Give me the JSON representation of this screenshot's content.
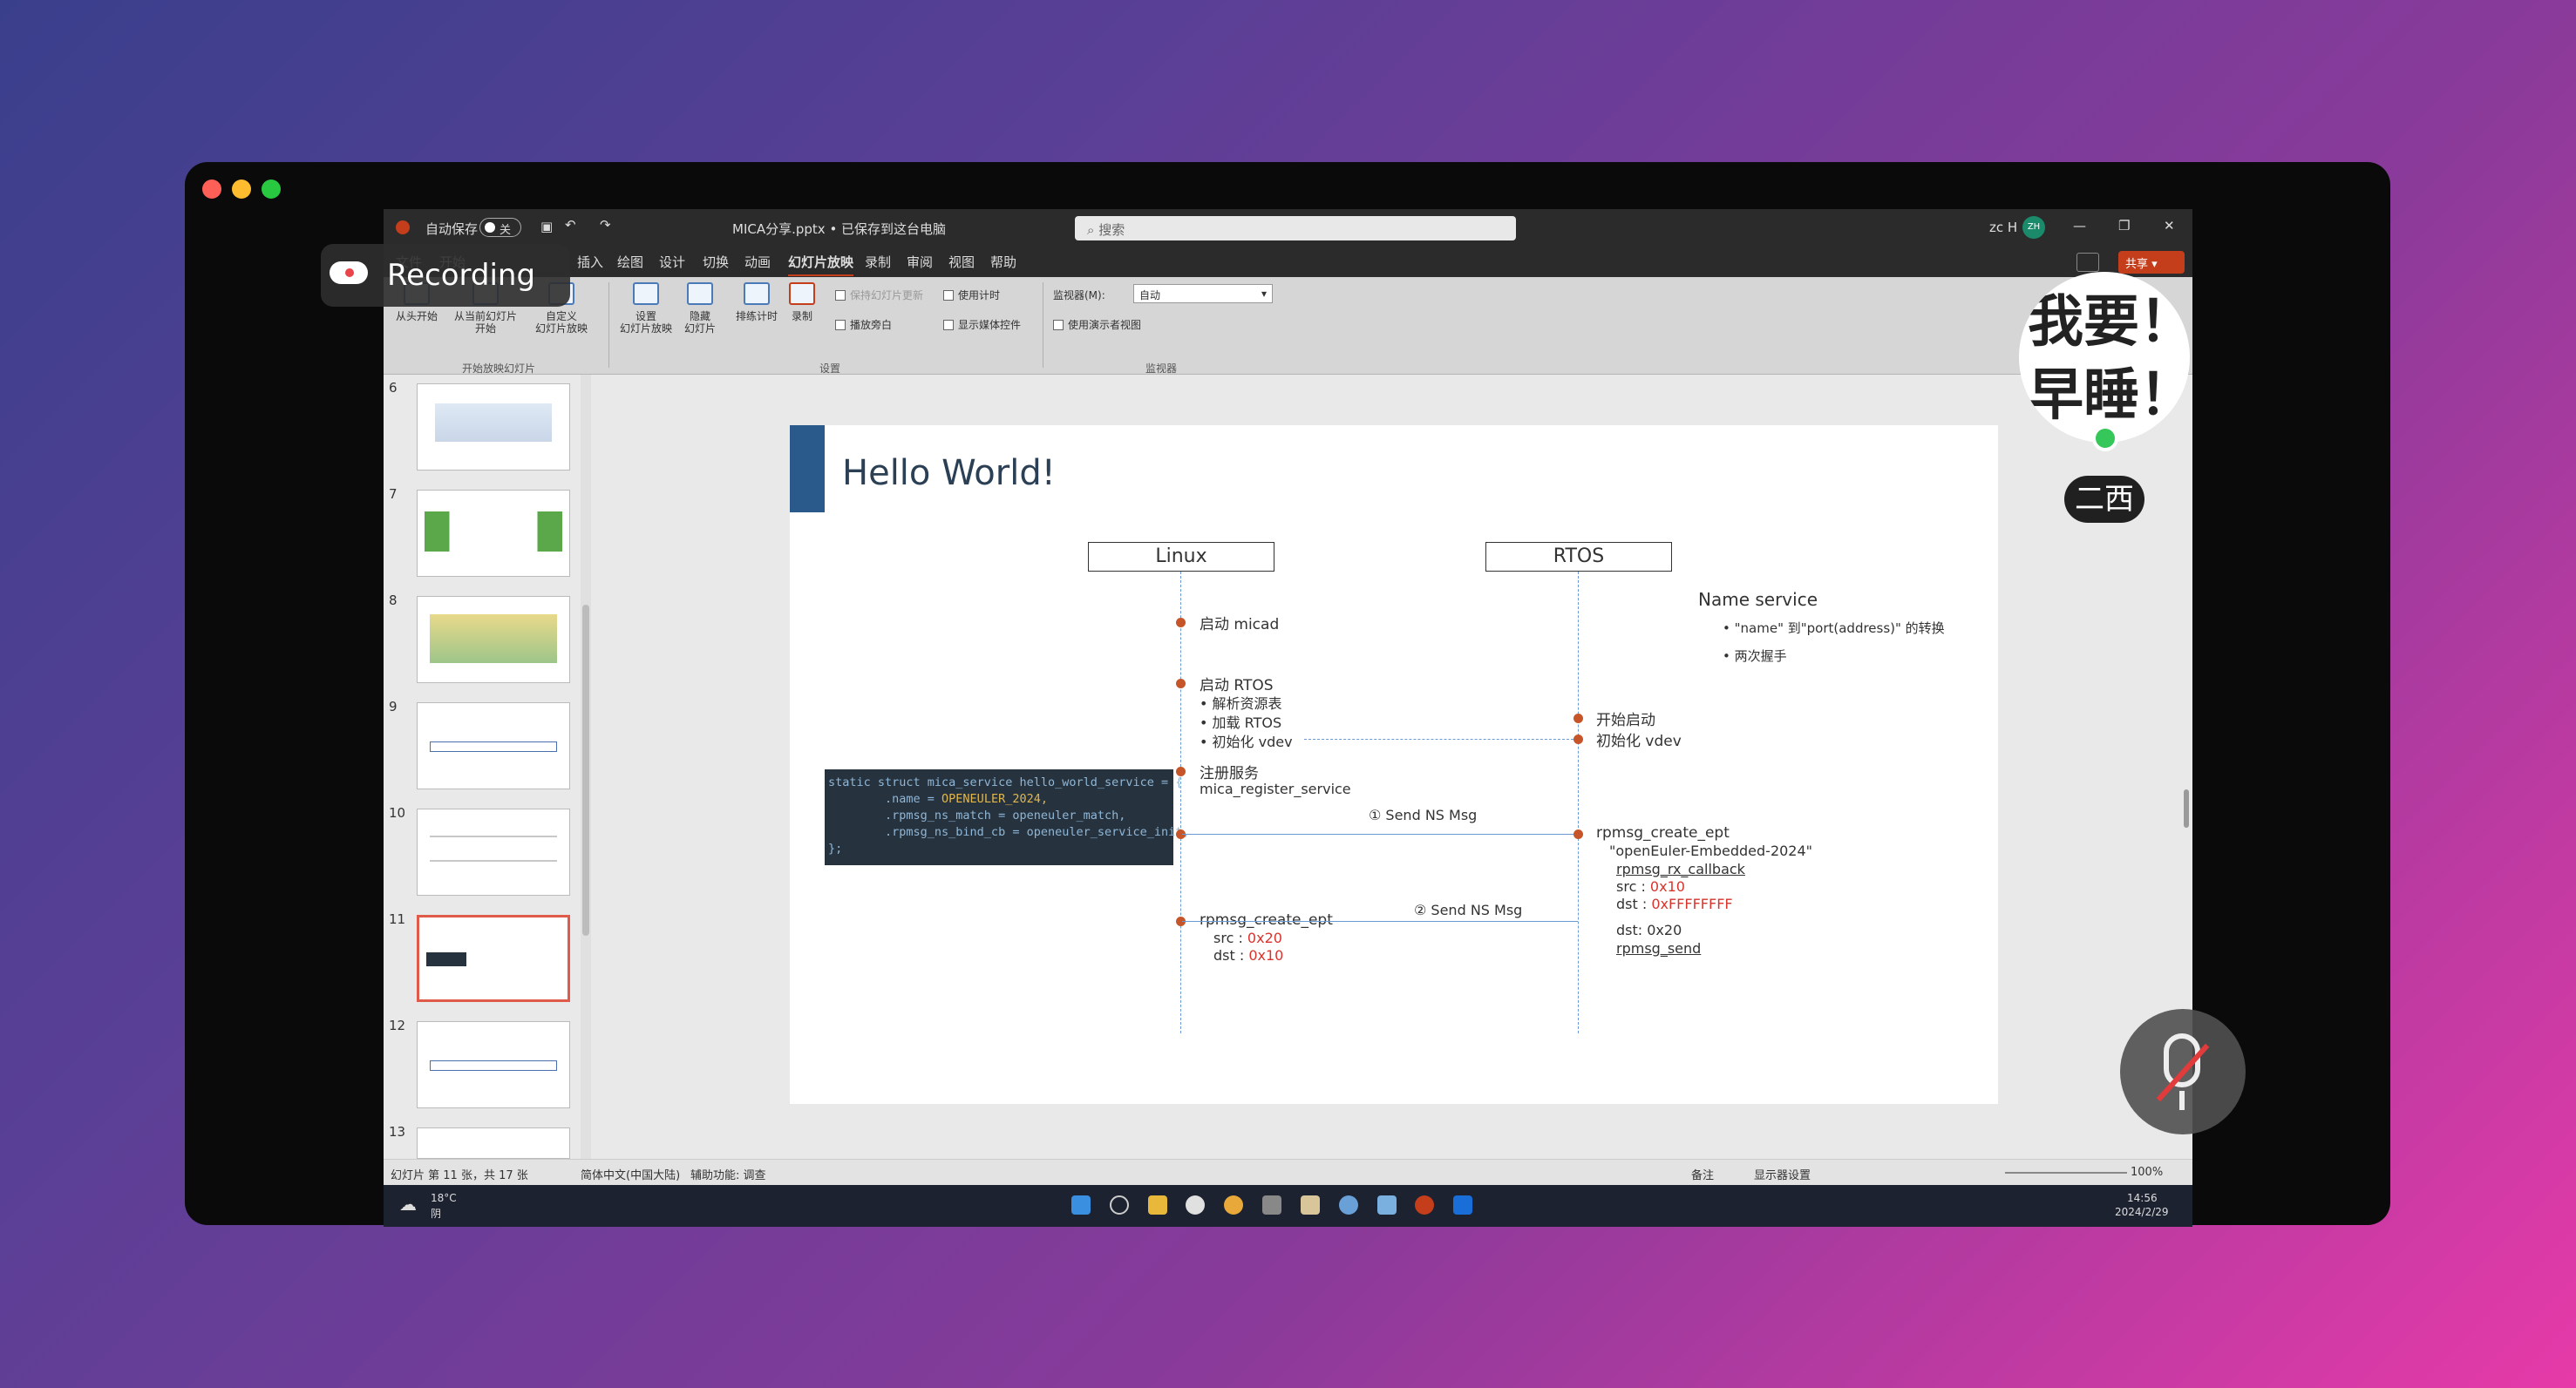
{
  "recording": {
    "label": "Recording"
  },
  "ppt": {
    "autosave": "自动保存",
    "autosave_state": "关",
    "filename": "MICA分享.pptx • 已保存到这台电脑",
    "search": "搜索",
    "user": "zc H",
    "avatar": "ZH",
    "menu": [
      "文件",
      "开始",
      "插入",
      "绘图",
      "设计",
      "切换",
      "动画",
      "幻灯片放映",
      "录制",
      "审阅",
      "视图",
      "帮助"
    ],
    "share": "共享",
    "ribbon": {
      "from_start": "从头开始",
      "from_current": "从当前幻灯片\n开始",
      "custom": "自定义\n幻灯片放映",
      "setup": "设置\n幻灯片放映",
      "hide": "隐藏\n幻灯片",
      "rehearse": "排练计时",
      "record": "录制",
      "chk_play_narr": "播放旁白",
      "chk_timing": "使用计时",
      "chk_media": "显示媒体控件",
      "chk_keep_updated": "保持幻灯片更新",
      "monitor_label": "监视器(M):",
      "monitor_value": "自动",
      "presenter": "使用演示者视图",
      "group_start": "开始放映幻灯片",
      "group_setup": "设置",
      "group_monitor": "监视器"
    },
    "thumbs": [
      "6",
      "7",
      "8",
      "9",
      "10",
      "11",
      "12",
      "13"
    ],
    "slide": {
      "title": "Hello World!",
      "linux": "Linux",
      "rtos": "RTOS",
      "l1": "启动 micad",
      "l2": "启动 RTOS",
      "b1": "解析资源表",
      "b2": "加载 RTOS",
      "b3": "初始化 vdev",
      "l3": "注册服务",
      "l4": "mica_register_service",
      "send1": "① Send NS Msg",
      "l5": "rpmsg_create_ept",
      "l5a": "src : ",
      "l5av": "0x20",
      "l5b": "dst : ",
      "l5bv": "0x10",
      "send2": "② Send NS Msg",
      "r1": "开始启动",
      "r2": "初始化 vdev",
      "r3": "rpmsg_create_ept",
      "r3a": "\"openEuler-Embedded-2024\"",
      "r3b": "rpmsg_rx_callback",
      "r3c": "src : ",
      "r3cv": "0x10",
      "r3d": "dst : ",
      "r3dv": "0xFFFFFFFF",
      "r4": "dst:  0x20",
      "r5": "rpmsg_send",
      "ns_title": "Name service",
      "ns1": "\"name\" 到\"port(address)\" 的转换",
      "ns2": "两次握手",
      "code": [
        "static struct mica_service hello_world_service = {",
        "        .name = ",
        "OPENEULER_2024,",
        "        .rpmsg_ns_match = openeuler_match,",
        "        .rpmsg_ns_bind_cb = openeuler_service_init,",
        "};"
      ]
    },
    "status": {
      "slide_info": "幻灯片 第 11 张，共 17 张",
      "lang": "简体中文(中国大陆)",
      "access": "辅助功能: 调查",
      "notes": "备注",
      "display": "显示器设置",
      "zoom": "100%"
    },
    "taskbar": {
      "weather": "18°C",
      "weather2": "阴",
      "time": "14:56",
      "date": "2024/2/29"
    }
  },
  "overlay": {
    "sticker_l1": "我要！",
    "sticker_l2": "早睡！",
    "name": "二西"
  },
  "colors": {
    "accent": "#c43e1c",
    "slide_title_bar": "#2a5a8c"
  }
}
